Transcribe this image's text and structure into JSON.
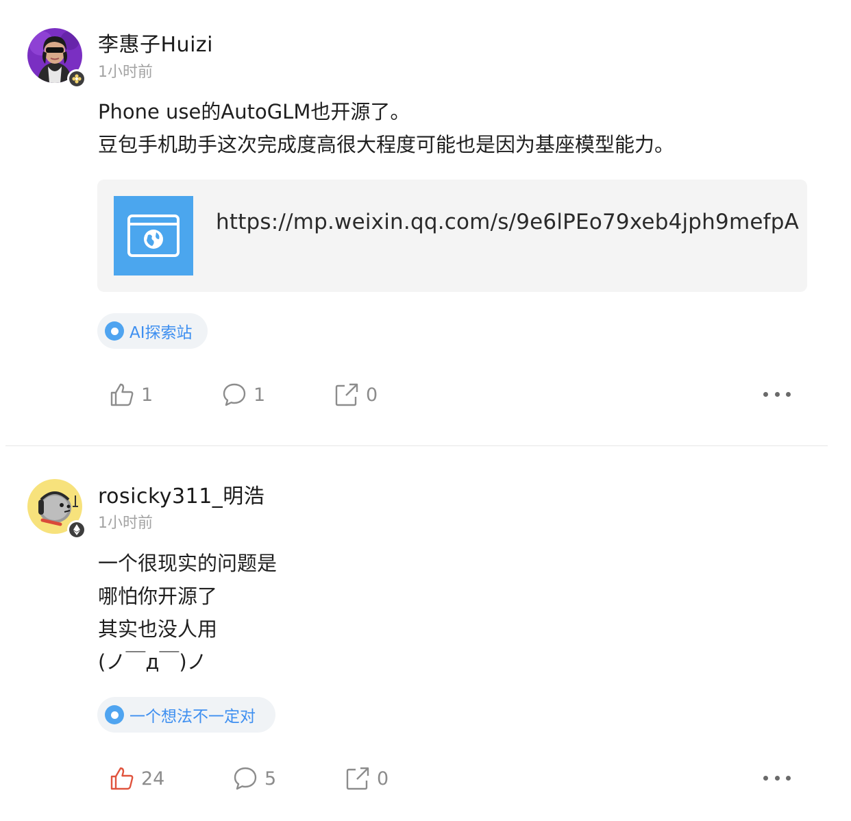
{
  "posts": [
    {
      "author": "李惠子Huizi",
      "time": "1小时前",
      "avatar_icon": "user-avatar-photo",
      "badge_icon": "flower-badge-icon",
      "content_lines": [
        "Phone use的AutoGLM也开源了。",
        "豆包手机助手这次完成度高很大程度可能也是因为基座模型能力。"
      ],
      "link": {
        "icon": "browser-globe-icon",
        "url": "https://mp.weixin.qq.com/s/9e6lPEo79xeb4jph9mefpA"
      },
      "topic": "AI探索站",
      "likes": "1",
      "comments": "1",
      "shares": "0",
      "liked": false
    },
    {
      "author": "rosicky311_明浩",
      "time": "1小时前",
      "avatar_icon": "cartoon-avatar",
      "badge_icon": "ethereum-badge-icon",
      "content_lines": [
        "一个很现实的问题是",
        "哪怕你开源了",
        "其实也没人用",
        "(ノ￣д￣)ノ"
      ],
      "topic": "一个想法不一定对",
      "likes": "24",
      "comments": "5",
      "shares": "0",
      "liked": true
    }
  ],
  "colors": {
    "accent_blue": "#3e8ff0",
    "topic_bg": "#f0f3f6",
    "link_thumb": "#4ba6ee",
    "liked_red": "#e0533d",
    "muted": "#8c8c8c"
  }
}
